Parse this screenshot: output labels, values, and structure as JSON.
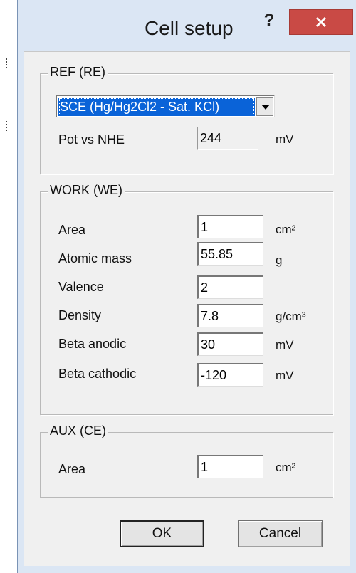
{
  "window": {
    "title": "Cell setup",
    "help_label": "?",
    "close_label": "✕"
  },
  "ref": {
    "group_title": "REF (RE)",
    "electrode_selected": "SCE (Hg/Hg2Cl2 - Sat. KCl)",
    "pot_label": "Pot vs NHE",
    "pot_value": "244",
    "pot_unit": "mV"
  },
  "work": {
    "group_title": "WORK (WE)",
    "fields": [
      {
        "label": "Area",
        "value": "1",
        "unit": "cm²"
      },
      {
        "label": "Atomic mass",
        "value": "55.85",
        "unit": "g"
      },
      {
        "label": "Valence",
        "value": "2",
        "unit": ""
      },
      {
        "label": "Density",
        "value": "7.8",
        "unit": "g/cm³"
      },
      {
        "label": "Beta anodic",
        "value": "30",
        "unit": "mV"
      },
      {
        "label": "Beta cathodic",
        "value": "-120",
        "unit": "mV"
      }
    ]
  },
  "aux": {
    "group_title": "AUX (CE)",
    "area_label": "Area",
    "area_value": "1",
    "area_unit": "cm²"
  },
  "buttons": {
    "ok": "OK",
    "cancel": "Cancel"
  },
  "colors": {
    "accent_selection": "#0a63d8",
    "close_button": "#c94a45",
    "frame": "#dbe6f4"
  }
}
